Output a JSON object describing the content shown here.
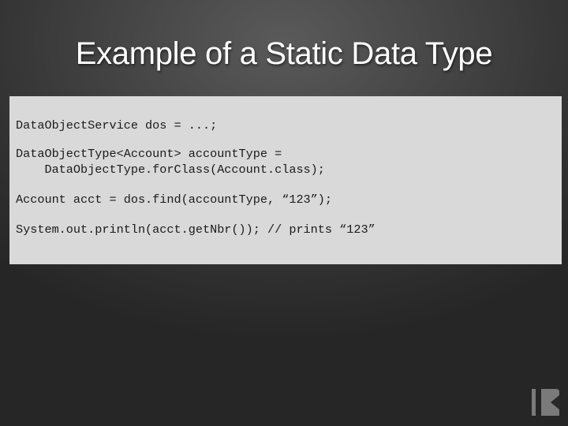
{
  "slide": {
    "title": "Example of a Static Data Type",
    "code_lines": [
      "DataObjectService dos = ...;",
      "DataObjectType<Account> accountType =",
      "    DataObjectType.forClass(Account.class);",
      "Account acct = dos.find(accountType, “123”);",
      "System.out.println(acct.getNbr()); // prints “123”"
    ],
    "logo": {
      "icon": "k-logo-icon"
    }
  },
  "colors": {
    "title_text": "#ffffff",
    "code_background": "#d9d9d9",
    "code_text": "#1a1a1a",
    "background_center": "#5a5a5a",
    "background_edge": "#262626",
    "logo": "#7a7a7a"
  }
}
